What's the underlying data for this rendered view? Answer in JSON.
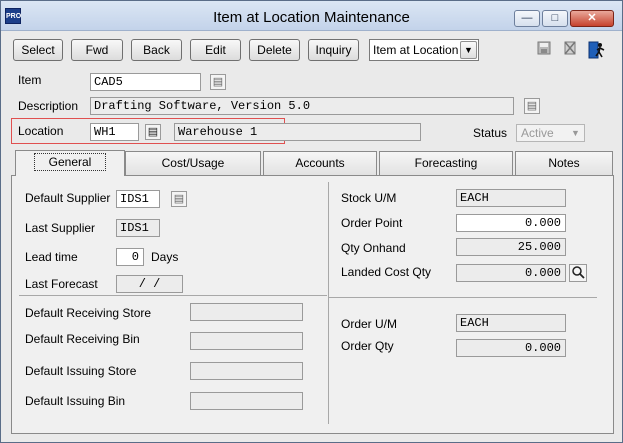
{
  "window": {
    "app_icon": "PRO",
    "title": "Item at Location Maintenance",
    "min_glyph": "—",
    "max_glyph": "□",
    "close_glyph": "✕"
  },
  "toolbar": {
    "select_label": "Select",
    "fwd_label": "Fwd",
    "back_label": "Back",
    "edit_label": "Edit",
    "delete_label": "Delete",
    "inquiry_label": "Inquiry",
    "view_select_value": "Item at Location",
    "icons": [
      "save-icon",
      "clear-icon",
      "exit-icon"
    ]
  },
  "header": {
    "item_label": "Item",
    "item_value": "CAD5",
    "description_label": "Description",
    "description_value": "Drafting Software, Version 5.0",
    "location_label": "Location",
    "location_value": "WH1",
    "location_name": "Warehouse 1",
    "status_label": "Status",
    "status_value": "Active"
  },
  "tabs": [
    {
      "label": "General"
    },
    {
      "label": "Cost/Usage"
    },
    {
      "label": "Accounts"
    },
    {
      "label": "Forecasting"
    },
    {
      "label": "Notes"
    }
  ],
  "general": {
    "default_supplier_label": "Default Supplier",
    "default_supplier_value": "IDS1",
    "last_supplier_label": "Last Supplier",
    "last_supplier_value": "IDS1",
    "lead_time_label": "Lead time",
    "lead_time_value": "0",
    "lead_time_unit": "Days",
    "last_forecast_label": "Last Forecast",
    "last_forecast_value": "/ /",
    "default_receiving_store_label": "Default Receiving Store",
    "default_receiving_store_value": "",
    "default_receiving_bin_label": "Default Receiving Bin",
    "default_receiving_bin_value": "",
    "default_issuing_store_label": "Default Issuing Store",
    "default_issuing_store_value": "",
    "default_issuing_bin_label": "Default Issuing Bin",
    "default_issuing_bin_value": "",
    "stock_um_label": "Stock U/M",
    "stock_um_value": "EACH",
    "order_point_label": "Order Point",
    "order_point_value": "0.000",
    "qty_onhand_label": "Qty Onhand",
    "qty_onhand_value": "25.000",
    "landed_cost_qty_label": "Landed Cost Qty",
    "landed_cost_qty_value": "0.000",
    "order_um_label": "Order U/M",
    "order_um_value": "EACH",
    "order_qty_label": "Order Qty",
    "order_qty_value": "0.000"
  },
  "colors": {
    "title_bar": "#c3d3ea",
    "close_button": "#c6422d",
    "location_highlight": "#e05050"
  }
}
